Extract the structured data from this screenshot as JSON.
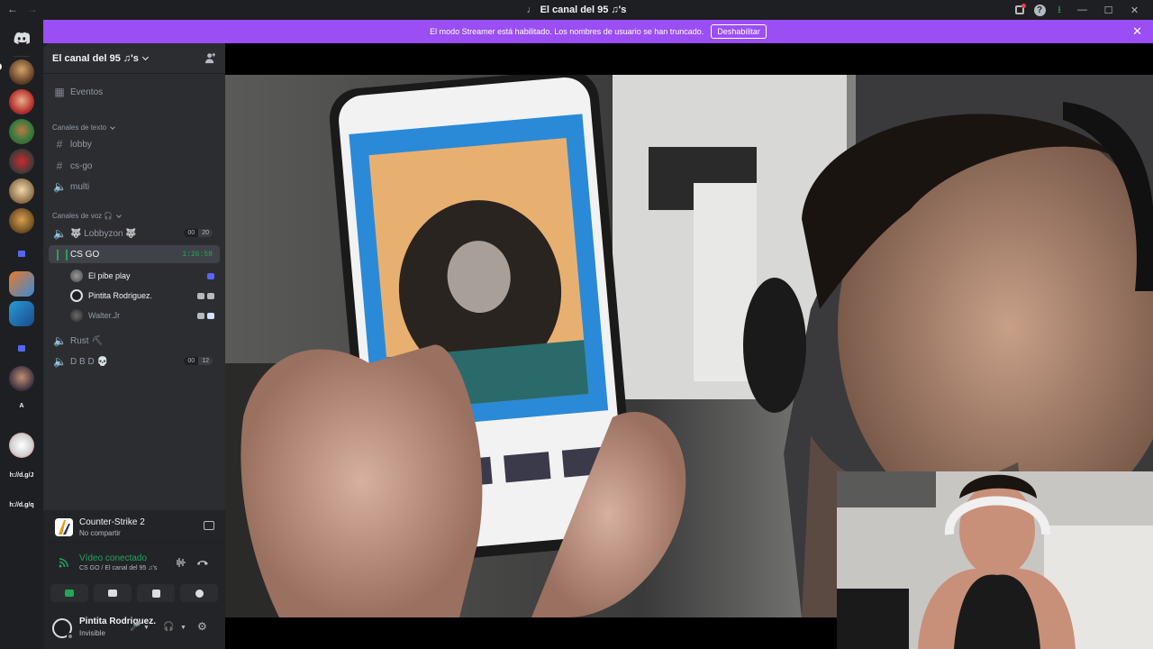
{
  "titlebar": {
    "back_icon": "arrow-left-icon",
    "forward_icon": "arrow-right-icon",
    "title": "El canal del 95 ♫'s"
  },
  "banner": {
    "text": "El modo Streamer está habilitado. Los nombres de usuario se han truncado.",
    "button_label": "Deshabilitar",
    "close_icon": "close-icon"
  },
  "server": {
    "name": "El canal del 95 ♫'s",
    "events_label": "Eventos",
    "text_category": "Canales de texto",
    "voice_category": "Canales de voz 🎧",
    "text_channels": [
      {
        "name": "lobby"
      },
      {
        "name": "cs-go"
      },
      {
        "name": "multi"
      }
    ],
    "voice_channels": [
      {
        "name": "🐺 Lobbyzon 🐺",
        "count_a": "00",
        "count_b": "20"
      },
      {
        "name": "CS GO",
        "timer": "1:26:58"
      },
      {
        "name": "Rust ⛏"
      },
      {
        "name": "D B D 💀",
        "count_a": "00",
        "count_b": "12"
      }
    ],
    "voice_users": [
      {
        "name": "El pibe play"
      },
      {
        "name": "Pintita Rodriguez."
      },
      {
        "name": "Walter.Jr"
      }
    ]
  },
  "guild_bar": {
    "text_items": [
      "A",
      "h://d.g/J",
      "h://d.g/q"
    ]
  },
  "activity": {
    "title": "Counter-Strike 2",
    "subtitle": "No compartir"
  },
  "voice_connection": {
    "status": "Vídeo conectado",
    "location": "CS GO / El canal del 95 ♫'s"
  },
  "user": {
    "name": "Pintita Rodriguez.",
    "status": "Invisible"
  },
  "colors": {
    "banner": "#9b4ef3",
    "connected_green": "#23a55a",
    "sidebar": "#2b2d31",
    "background": "#1e1f22"
  }
}
